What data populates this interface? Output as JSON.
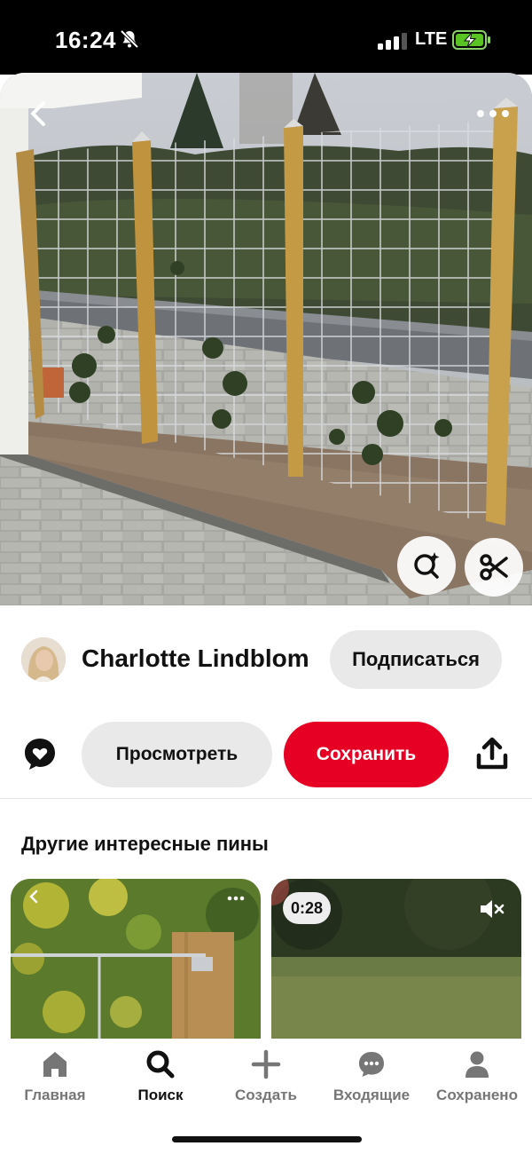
{
  "status_bar": {
    "time": "16:24",
    "network": "LTE",
    "icons": [
      "bell-off-icon",
      "signal-icon",
      "battery-charging-icon"
    ]
  },
  "hero": {
    "icons": [
      "back-icon",
      "more-icon",
      "visual-search-icon",
      "cutout-icon"
    ]
  },
  "author": {
    "name": "Charlotte Lindblom",
    "follow_label": "Подписаться"
  },
  "actions": {
    "view_label": "Просмотреть",
    "save_label": "Сохранить",
    "icons": [
      "comment-icon",
      "share-icon"
    ]
  },
  "more_pins": {
    "title": "Другие интересные пины",
    "cards": [
      {
        "kind": "image"
      },
      {
        "kind": "video",
        "duration": "0:28"
      }
    ]
  },
  "bottom_nav": {
    "items": [
      {
        "label": "Главная",
        "icon": "home-icon",
        "active": false
      },
      {
        "label": "Поиск",
        "icon": "search-icon",
        "active": true
      },
      {
        "label": "Создать",
        "icon": "plus-icon",
        "active": false
      },
      {
        "label": "Входящие",
        "icon": "chat-icon",
        "active": false
      },
      {
        "label": "Сохранено",
        "icon": "profile-icon",
        "active": false
      }
    ]
  },
  "colors": {
    "save_button": "#e60023",
    "secondary_button": "#e9e9e9",
    "active_nav": "#111111",
    "inactive_nav": "#767676"
  }
}
